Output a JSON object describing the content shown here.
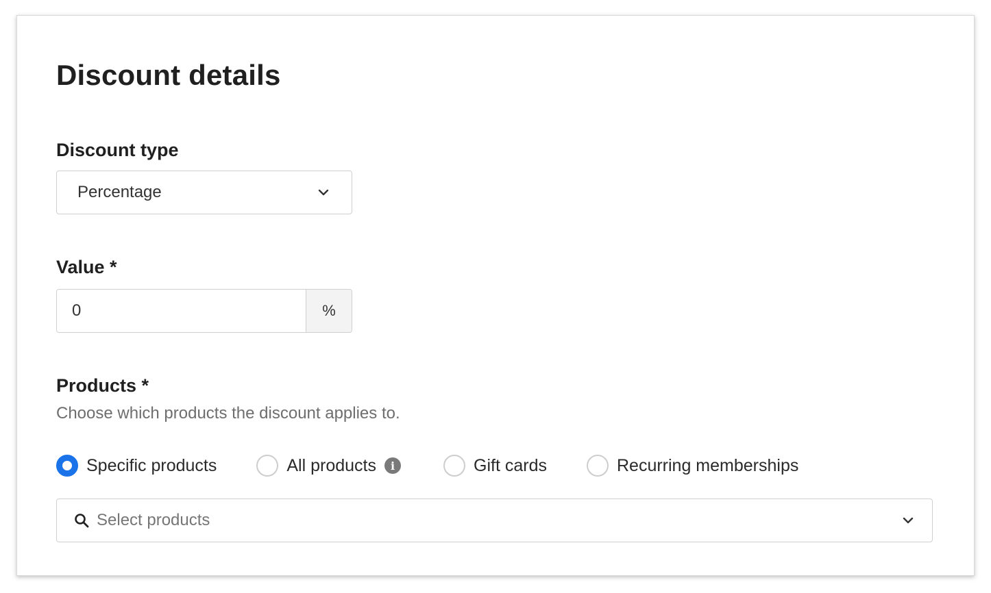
{
  "card": {
    "title": "Discount details"
  },
  "discount_type": {
    "label": "Discount type",
    "selected": "Percentage"
  },
  "value": {
    "label": "Value *",
    "current": "0",
    "suffix": "%"
  },
  "products": {
    "label": "Products *",
    "help": "Choose which products the discount applies to.",
    "options": [
      {
        "label": "Specific products",
        "checked": true
      },
      {
        "label": "All products",
        "checked": false,
        "icon": "info-icon"
      },
      {
        "label": "Gift cards",
        "checked": false
      },
      {
        "label": "Recurring memberships",
        "checked": false
      }
    ],
    "search_placeholder": "Select products"
  },
  "colors": {
    "accent": "#1a73e8",
    "border": "#cfcfcf",
    "muted_text": "#6e6e6e"
  }
}
